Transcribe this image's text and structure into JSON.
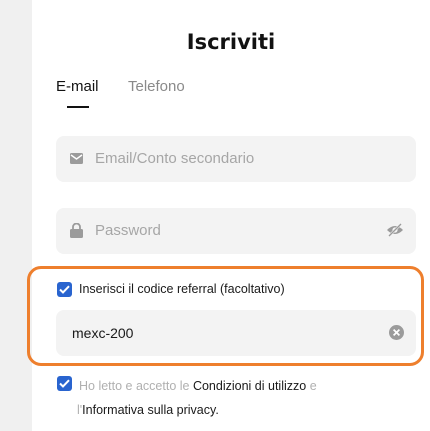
{
  "header": {
    "title": "Iscriviti"
  },
  "tabs": [
    {
      "label": "E-mail",
      "active": true
    },
    {
      "label": "Telefono",
      "active": false
    }
  ],
  "form": {
    "email_placeholder": "Email/Conto secondario",
    "password_placeholder": "Password",
    "referral": {
      "checkbox_label": "Inserisci il codice referral (facoltativo)",
      "checked": true,
      "value": "mexc-200"
    },
    "terms": {
      "checked": true,
      "part1": "Ho letto e accetto le ",
      "link1": "Condizioni di utilizzo",
      "part2": " e",
      "part3": "l'",
      "link2": "Informativa sulla privacy",
      "part4": "."
    }
  },
  "colors": {
    "accent": "#2964cf",
    "highlight": "#ee7f2d",
    "field_bg": "#f3f3f3",
    "muted": "#a6a6a6"
  },
  "icons": {
    "email": "mail-icon",
    "password": "lock-icon",
    "visibility": "eye-off-icon",
    "clear": "clear-icon",
    "check": "checkmark-icon"
  }
}
